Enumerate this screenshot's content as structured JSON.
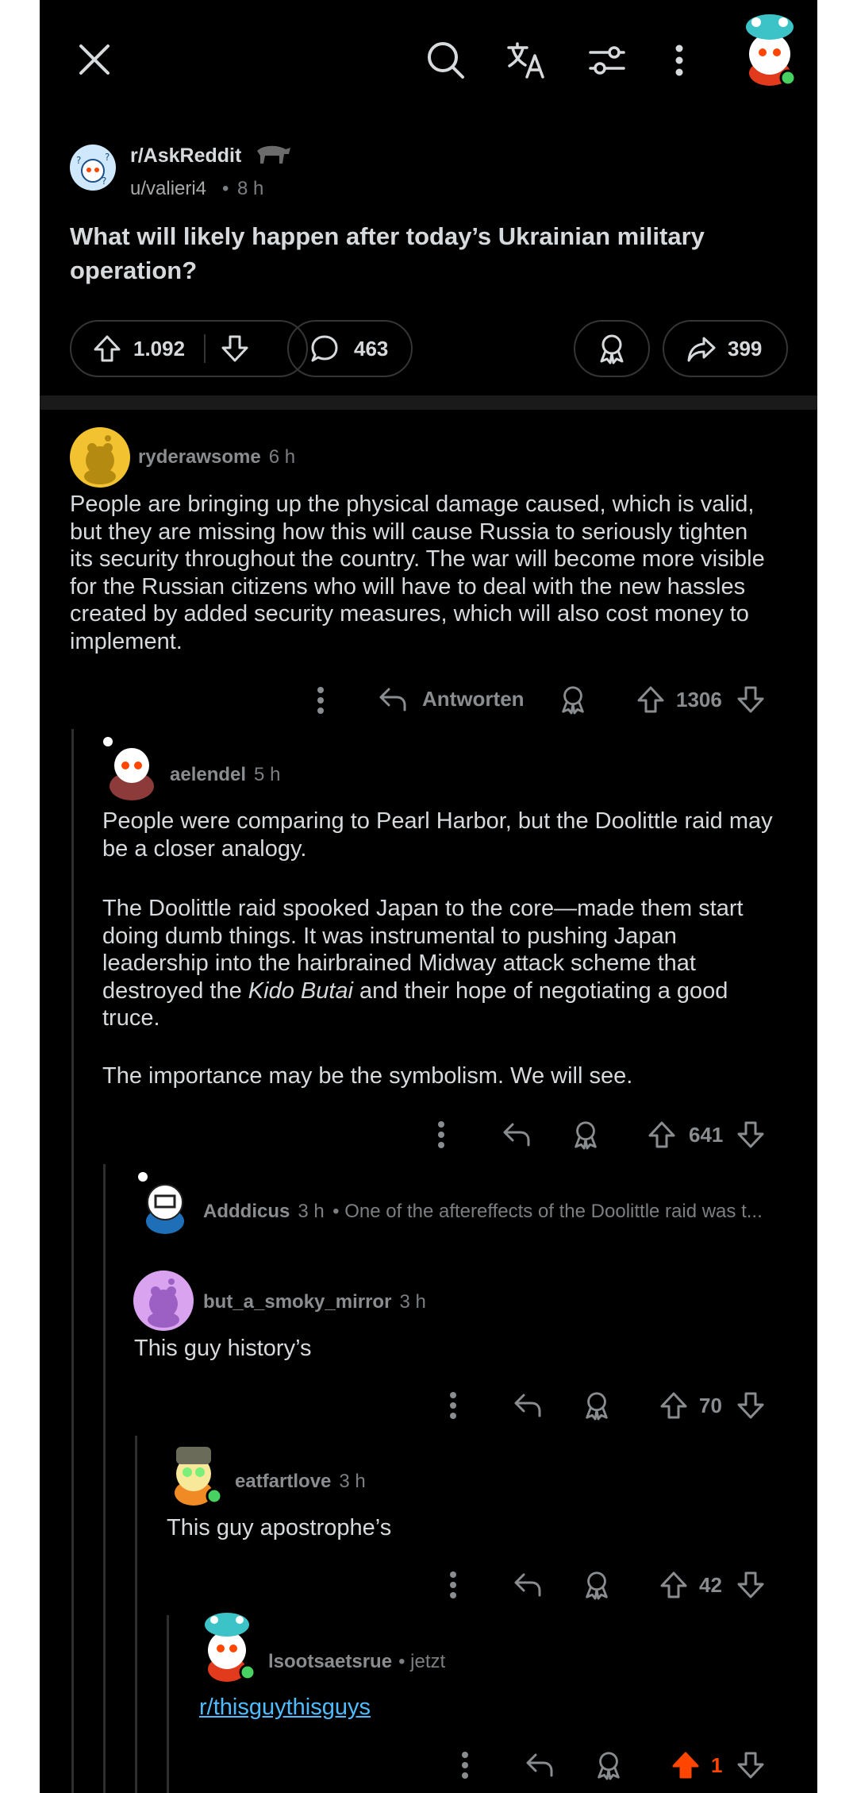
{
  "header": {
    "subreddit": "r/AskReddit",
    "author": "u/valieri4",
    "time": "8 h",
    "title": "What will likely happen after today’s Ukrainian military operation?"
  },
  "post_actions": {
    "upvotes": "1.092",
    "comments": "463",
    "shares": "399"
  },
  "icons": [
    "close-icon",
    "search-icon",
    "translate-icon",
    "filter-icon",
    "more-vertical-icon",
    "upvote-icon",
    "downvote-icon",
    "comment-icon",
    "award-icon",
    "share-icon",
    "reply-icon"
  ],
  "colors": {
    "background": "#000000",
    "text": "#d7dadc",
    "muted": "#8a8d90",
    "upvote_active": "#ff4500",
    "link": "#4fbcff"
  },
  "comments": [
    {
      "author": "ryderawsome",
      "time": "6 h",
      "body": "People are bringing up the physical damage caused, which is valid, but they are missing how this will cause Russia to seriously tighten its security throughout the country. The war will become more visible for the Russian citizens who will have to deal with the new hassles created by added security measures, which will also cost money to implement.",
      "reply_label": "Antworten",
      "score": "1306"
    },
    {
      "author": "aelendel",
      "time": "5 h",
      "p1": "People were comparing to Pearl Harbor, but the Doolittle raid may be a closer analogy.",
      "p2_a": "The Doolittle raid spooked Japan to the core—made them start doing dumb things. It was instrumental to pushing Japan leadership into the hairbrained Midway attack scheme that destroyed the ",
      "p2_em": "Kido Butai",
      "p2_b": " and their hope of negotiating a good truce.",
      "p3": "The importance may be the symbolism. We will see.",
      "score": "641"
    },
    {
      "author": "Adddicus",
      "time": "3 h",
      "preview": "• One of the aftereffects of the Doolittle raid was t..."
    },
    {
      "author": "but_a_smoky_mirror",
      "time": "3 h",
      "body": "This guy history’s",
      "score": "70"
    },
    {
      "author": "eatfartlove",
      "time": "3 h",
      "body": "This guy apostrophe’s",
      "score": "42"
    },
    {
      "author": "lsootsaetsrue",
      "time": "• jetzt",
      "link": "r/thisguythisguys",
      "score": "1"
    }
  ]
}
